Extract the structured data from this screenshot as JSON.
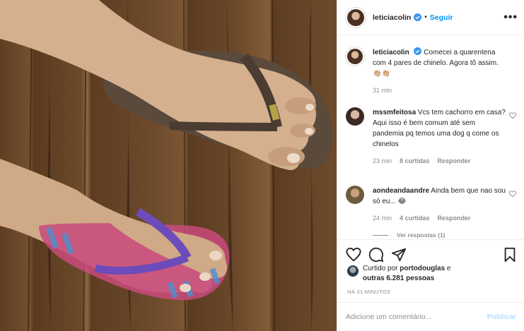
{
  "post": {
    "username": "leticiacolin",
    "follow_label": "Seguir",
    "more_label": "•••",
    "dot": "•"
  },
  "caption": {
    "username": "leticiacolin",
    "text": "Comecei a quarentena com 4 pares de chinelo. Agora tô assim. 👏🏼👏🏼",
    "time": "31 min"
  },
  "comments": [
    {
      "username": "mssmfeitosa",
      "text": "Vcs tem cachorro em casa? Aqui isso é bem comum até sem pandemia pq temos uma dog q come os chinelos",
      "time": "23 min",
      "likes": "8 curtidas",
      "reply": "Responder"
    },
    {
      "username": "aondeandaandre",
      "text": "Ainda bem que nao sou só eu... 😂",
      "time": "24 min",
      "likes": "4 curtidas",
      "reply": "Responder"
    }
  ],
  "view_replies": "Ver respostas (1)",
  "likes": {
    "prefix": "Curtido por",
    "user": "portodouglas",
    "middle": "e",
    "others": "outras 6.281 pessoas"
  },
  "timestamp": "HÁ 31 MINUTOS",
  "comment_box": {
    "placeholder": "Adicione um comentário...",
    "post_label": "Publicar"
  },
  "colors": {
    "accent": "#0095f6",
    "post_disabled": "#b3dbff",
    "secondary_text": "#8e8e8e",
    "verified": "#3897f0"
  },
  "icons": [
    "verified-icon",
    "more-icon",
    "heart-icon",
    "comment-icon",
    "share-icon",
    "bookmark-icon"
  ]
}
